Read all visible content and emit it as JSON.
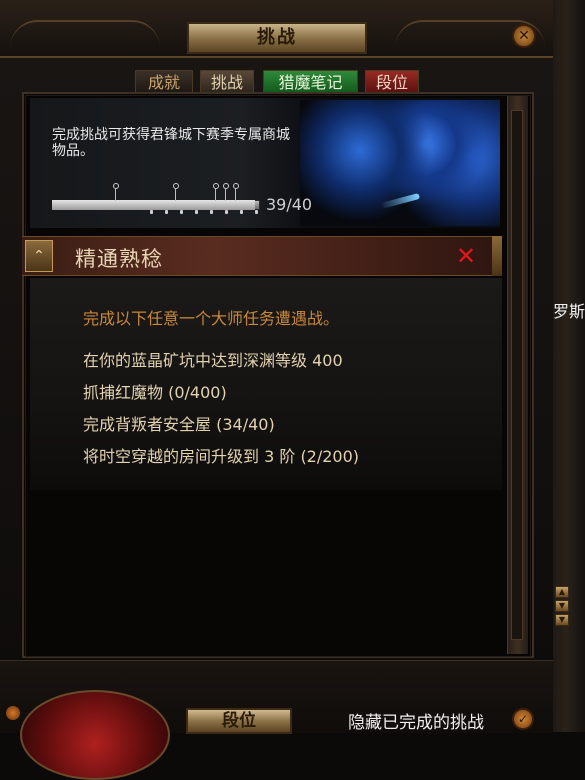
{
  "window": {
    "title": "挑战",
    "close_glyph": "✕"
  },
  "tabs": [
    {
      "label": "成就"
    },
    {
      "label": "挑战"
    },
    {
      "label": "猎魔笔记"
    },
    {
      "label": "段位"
    }
  ],
  "banner": {
    "description": "完成挑战可获得君锋城下赛季专属商城物品。",
    "progress": {
      "current": 39,
      "total": 40,
      "label": "39/40"
    }
  },
  "challenge": {
    "title": "精通熟稔",
    "icon": "chevron-up-icon",
    "close_glyph": "✕",
    "intro": "完成以下任意一个大师任务遭遇战。",
    "tasks": [
      {
        "text": "在你的蓝晶矿坑中达到深渊等级 400"
      },
      {
        "text": "抓捕红魔物 (0/400)"
      },
      {
        "text": "完成背叛者安全屋 (34/40)"
      },
      {
        "text": "将时空穿越的房间升级到 3 阶 (2/200)"
      }
    ]
  },
  "footer": {
    "tier_button": "段位",
    "hide_completed": "隐藏已完成的挑战",
    "hide_toggle_glyph": "✓"
  },
  "side": {
    "partial_text": "罗斯"
  },
  "colors": {
    "accent_orange": "#c8883a",
    "task_text": "#e2d2b0",
    "close_red": "#e5161a",
    "tab_green": "#2f8a3a",
    "tab_red": "#9a2a24"
  }
}
